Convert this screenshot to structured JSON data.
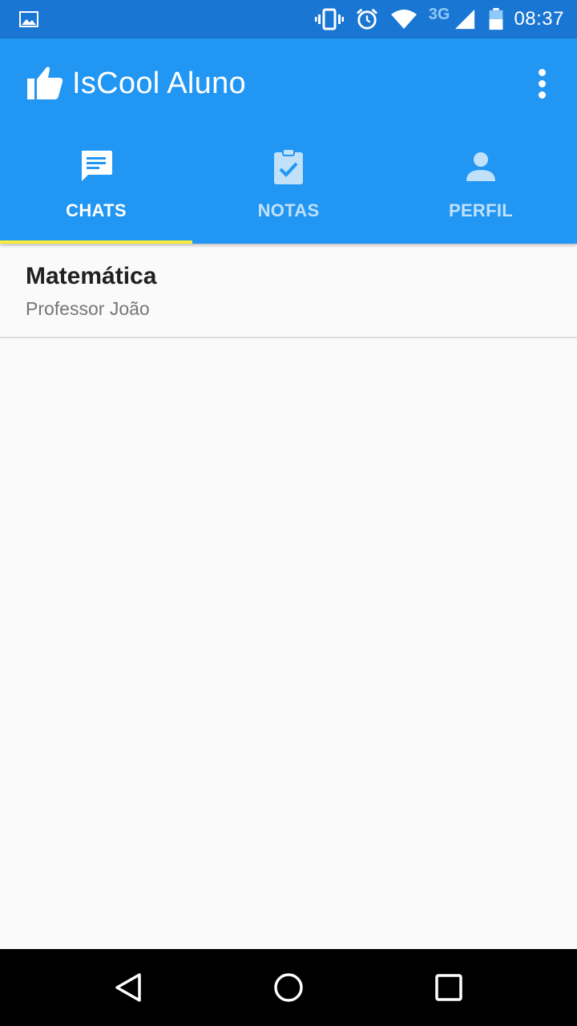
{
  "status_bar": {
    "left_icons": [
      "image-icon"
    ],
    "right_icons": [
      "vibrate-icon",
      "alarm-icon",
      "wifi-icon",
      "signal-icon",
      "battery-icon"
    ],
    "network_type": "3G",
    "time": "08:37"
  },
  "app_bar": {
    "title": "IsCool Aluno",
    "logo_icon": "thumbs-up-icon",
    "overflow_icon": "more-vert-icon",
    "background": "#2196f3",
    "status_bar_color": "#1976d2",
    "indicator_color": "#ffeb3b"
  },
  "tabs": [
    {
      "label": "CHATS",
      "icon": "chat-icon",
      "selected": true
    },
    {
      "label": "NOTAS",
      "icon": "assignment-check-icon",
      "selected": false
    },
    {
      "label": "PERFIL",
      "icon": "person-icon",
      "selected": false
    }
  ],
  "chats": [
    {
      "title": "Matemática",
      "subtitle": "Professor João"
    }
  ],
  "nav_bar": {
    "buttons": [
      "back-icon",
      "home-icon",
      "recents-icon"
    ]
  }
}
